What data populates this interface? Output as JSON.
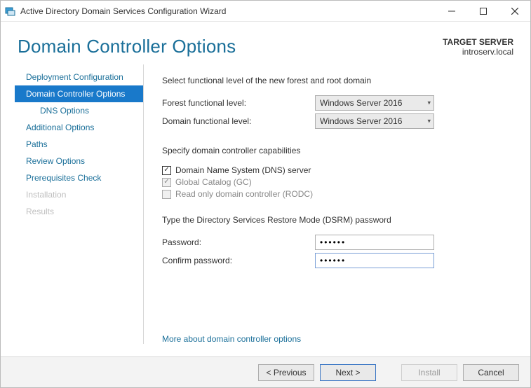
{
  "window": {
    "title": "Active Directory Domain Services Configuration Wizard"
  },
  "header": {
    "title": "Domain Controller Options",
    "target_label": "TARGET SERVER",
    "target_value": "introserv.local"
  },
  "sidebar": {
    "items": [
      {
        "label": "Deployment Configuration",
        "state": "normal"
      },
      {
        "label": "Domain Controller Options",
        "state": "selected"
      },
      {
        "label": "DNS Options",
        "state": "sub"
      },
      {
        "label": "Additional Options",
        "state": "normal"
      },
      {
        "label": "Paths",
        "state": "normal"
      },
      {
        "label": "Review Options",
        "state": "normal"
      },
      {
        "label": "Prerequisites Check",
        "state": "normal"
      },
      {
        "label": "Installation",
        "state": "disabled"
      },
      {
        "label": "Results",
        "state": "disabled"
      }
    ]
  },
  "content": {
    "functional_heading": "Select functional level of the new forest and root domain",
    "forest_label": "Forest functional level:",
    "forest_value": "Windows Server 2016",
    "domain_label": "Domain functional level:",
    "domain_value": "Windows Server 2016",
    "capabilities_heading": "Specify domain controller capabilities",
    "dns_label": "Domain Name System (DNS) server",
    "dns_checked": true,
    "gc_label": "Global Catalog (GC)",
    "gc_checked": true,
    "rodc_label": "Read only domain controller (RODC)",
    "rodc_checked": false,
    "dsrm_heading": "Type the Directory Services Restore Mode (DSRM) password",
    "password_label": "Password:",
    "password_value": "••••••",
    "confirm_label": "Confirm password:",
    "confirm_value": "••••••",
    "more_link": "More about domain controller options"
  },
  "footer": {
    "previous": "< Previous",
    "next": "Next >",
    "install": "Install",
    "cancel": "Cancel"
  }
}
